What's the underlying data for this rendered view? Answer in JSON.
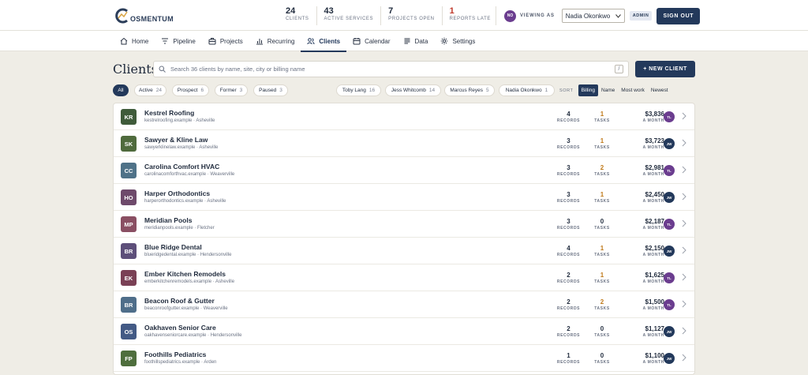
{
  "app": {
    "logo_text": "OSMENTUM",
    "brand_color": "#23395b"
  },
  "stats": [
    {
      "num": "24",
      "label": "CLIENTS",
      "late": false
    },
    {
      "num": "43",
      "label": "ACTIVE SERVICES",
      "late": false
    },
    {
      "num": "7",
      "label": "PROJECTS OPEN",
      "late": false
    },
    {
      "num": "1",
      "label": "REPORTS LATE",
      "late": true
    }
  ],
  "viewas": {
    "avatar": "NO",
    "label": "VIEWING AS",
    "selected": "Nadia Okonkwo",
    "role": "ADMIN",
    "signout": "SIGN OUT"
  },
  "nav": [
    {
      "label": "Home",
      "icon": "home-icon",
      "active": false
    },
    {
      "label": "Pipeline",
      "icon": "filter-icon",
      "active": false
    },
    {
      "label": "Projects",
      "icon": "briefcase-icon",
      "active": false
    },
    {
      "label": "Recurring",
      "icon": "bar-chart-icon",
      "active": false
    },
    {
      "label": "Clients",
      "icon": "users-icon",
      "active": true
    },
    {
      "label": "Calendar",
      "icon": "calendar-icon",
      "active": false
    },
    {
      "label": "Data",
      "icon": "lines-icon",
      "active": false
    },
    {
      "label": "Settings",
      "icon": "gear-icon",
      "active": false
    }
  ],
  "page": {
    "title": "Clients",
    "search_placeholder": "Search 36 clients by name, site, city or billing name",
    "search_shortcut": "/",
    "new_client": "+ NEW CLIENT"
  },
  "status_filters": [
    {
      "label": "All",
      "count": "",
      "active": true
    },
    {
      "label": "Active",
      "count": "24",
      "active": false
    },
    {
      "label": "Prospect",
      "count": "6",
      "active": false
    },
    {
      "label": "Former",
      "count": "3",
      "active": false
    },
    {
      "label": "Paused",
      "count": "3",
      "active": false
    }
  ],
  "owner_filters": [
    {
      "label": "Toby Lang",
      "count": "16"
    },
    {
      "label": "Jess Whitcomb",
      "count": "14"
    },
    {
      "label": "Marcus Reyes",
      "count": "5"
    },
    {
      "label": "Nadia Okonkwo",
      "count": "1"
    }
  ],
  "sort": {
    "label": "SORT",
    "options": [
      {
        "label": "Billing",
        "active": true
      },
      {
        "label": "Name",
        "active": false
      },
      {
        "label": "Most work",
        "active": false
      },
      {
        "label": "Newest",
        "active": false
      }
    ]
  },
  "metric_labels": {
    "records": "RECORDS",
    "tasks": "TASKS",
    "money": "A MONTH"
  },
  "clients": [
    {
      "initials": "KR",
      "color": "#3f5b3a",
      "name": "Kestrel Roofing",
      "sub": "kestrelroofing.example · Asheville",
      "records": "4",
      "tasks": "1",
      "money": "$3,836",
      "owner": "TL",
      "owner_color": "#6b3d8f"
    },
    {
      "initials": "SK",
      "color": "#4f6b3d",
      "name": "Sawyer & Kline Law",
      "sub": "sawyerklinelaw.example · Asheville",
      "records": "3",
      "tasks": "1",
      "money": "$3,723",
      "owner": "JW",
      "owner_color": "#23395b"
    },
    {
      "initials": "CC",
      "color": "#4f7288",
      "name": "Carolina Comfort HVAC",
      "sub": "carolinacomforthvac.example · Weaverville",
      "records": "3",
      "tasks": "2",
      "money": "$2,981",
      "owner": "TL",
      "owner_color": "#6b3d8f"
    },
    {
      "initials": "HO",
      "color": "#6e4a6b",
      "name": "Harper Orthodontics",
      "sub": "harperorthodontics.example · Asheville",
      "records": "3",
      "tasks": "1",
      "money": "$2,450",
      "owner": "JW",
      "owner_color": "#23395b"
    },
    {
      "initials": "MP",
      "color": "#8a4f63",
      "name": "Meridian Pools",
      "sub": "meridianpools.example · Fletcher",
      "records": "3",
      "tasks": "0",
      "money": "$2,187",
      "owner": "TL",
      "owner_color": "#6b3d8f"
    },
    {
      "initials": "BR",
      "color": "#5d4f7a",
      "name": "Blue Ridge Dental",
      "sub": "blueridgedental.example · Hendersonville",
      "records": "4",
      "tasks": "1",
      "money": "$2,150",
      "owner": "JW",
      "owner_color": "#23395b"
    },
    {
      "initials": "EK",
      "color": "#7a4055",
      "name": "Ember Kitchen Remodels",
      "sub": "emberkitchenremodels.example · Asheville",
      "records": "2",
      "tasks": "1",
      "money": "$1,625",
      "owner": "TL",
      "owner_color": "#6b3d8f"
    },
    {
      "initials": "BR",
      "color": "#4f6e8a",
      "name": "Beacon Roof & Gutter",
      "sub": "beaconroofgutter.example · Weaverville",
      "records": "2",
      "tasks": "2",
      "money": "$1,500",
      "owner": "TL",
      "owner_color": "#6b3d8f"
    },
    {
      "initials": "OS",
      "color": "#435a85",
      "name": "Oakhaven Senior Care",
      "sub": "oakhavenseniorcare.example · Hendersonville",
      "records": "2",
      "tasks": "0",
      "money": "$1,127",
      "owner": "JW",
      "owner_color": "#23395b"
    },
    {
      "initials": "FP",
      "color": "#4e6e3d",
      "name": "Foothills Pediatrics",
      "sub": "foothillspediatrics.example · Arden",
      "records": "1",
      "tasks": "0",
      "money": "$1,100",
      "owner": "JW",
      "owner_color": "#23395b"
    }
  ]
}
